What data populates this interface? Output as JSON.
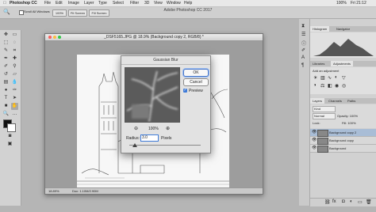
{
  "menubar": {
    "apple": "",
    "items": [
      "Photoshop CC",
      "File",
      "Edit",
      "Image",
      "Layer",
      "Type",
      "Select",
      "Filter",
      "3D",
      "View",
      "Window",
      "Help"
    ],
    "status": {
      "battery": "100%",
      "clock": "Fri 21:12"
    }
  },
  "options": {
    "scroll_all_windows": "Scroll All Windows",
    "zoom_100": "100%",
    "fit_screen": "Fit Screen",
    "fill_screen": "Fill Screen"
  },
  "app_title": "Adobe Photoshop CC 2017",
  "document": {
    "title": "_DSF5165.JPG @ 18.9% (Background copy 2, RGB/8) *",
    "zoom": "18.89%",
    "doc_info": "Doc: 1.10M/2.90M"
  },
  "dialog": {
    "title": "Gaussian Blur",
    "ok": "OK",
    "cancel": "Cancel",
    "preview_label": "Preview",
    "preview_checked": true,
    "zoom_value": "100%",
    "radius_label": "Radius:",
    "radius_value": "3.0",
    "radius_unit": "Pixels",
    "slider_fraction": 0.08
  },
  "panels": {
    "top_tabs": [
      "Histogram",
      "Navigator"
    ],
    "mid_tabs": [
      "Libraries",
      "Adjustments"
    ],
    "add_adjustment": "Add an adjustment",
    "layer_tabs": [
      "Layers",
      "Channels",
      "Paths"
    ],
    "kind": "Kind",
    "blend_mode": "Normal",
    "opacity": "Opacity: 100%",
    "lock": "Lock:",
    "fill": "Fill: 100%",
    "layers": [
      {
        "name": "Background copy 2",
        "selected": true
      },
      {
        "name": "Background copy",
        "selected": false
      },
      {
        "name": "Background",
        "selected": false
      }
    ]
  },
  "colors": {
    "accent": "#3f7bd8",
    "selected_layer": "#a9bdd6"
  }
}
